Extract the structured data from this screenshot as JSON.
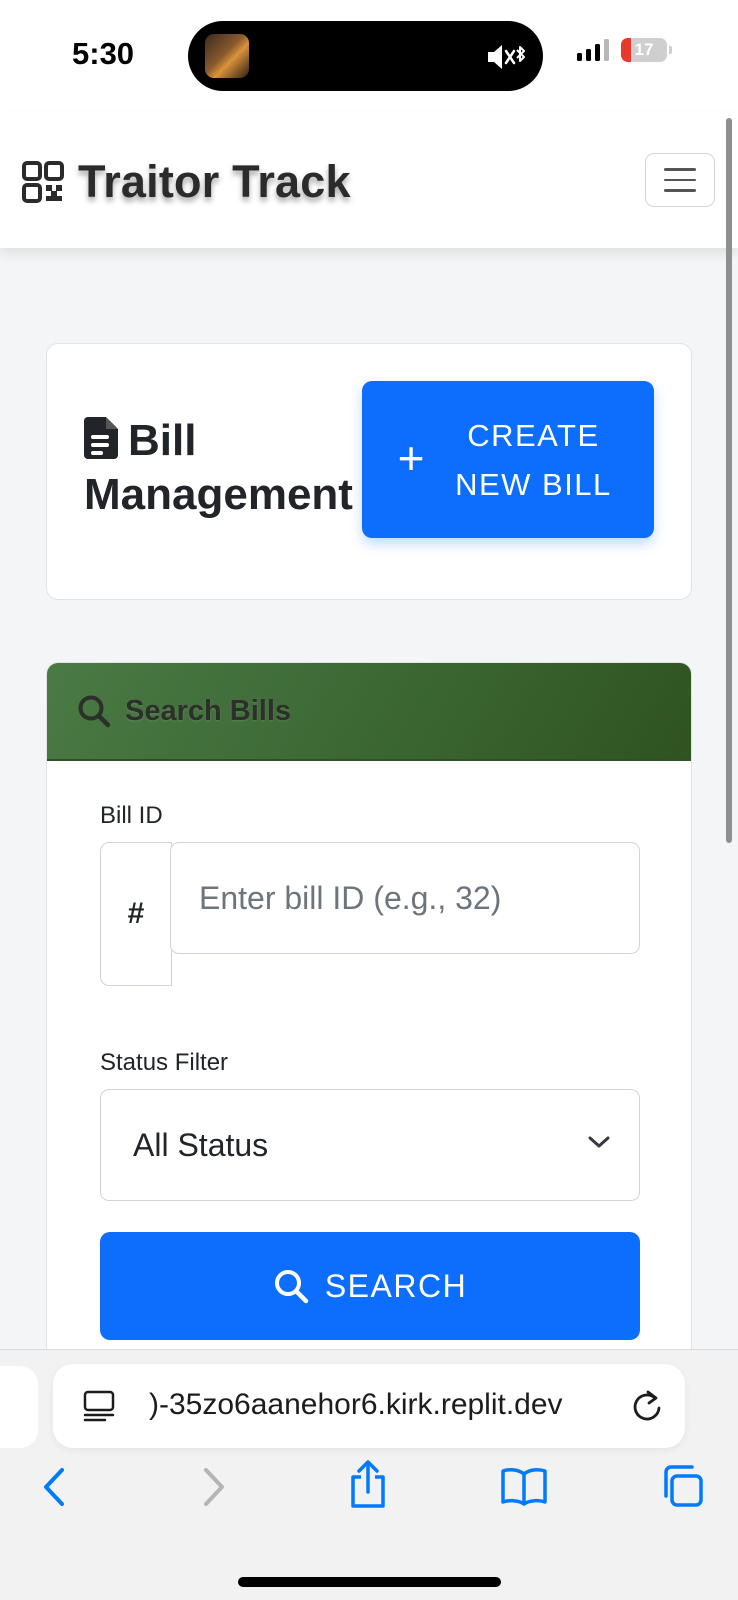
{
  "status_bar": {
    "time": "5:30",
    "battery": "17"
  },
  "navbar": {
    "brand": "Traitor Track"
  },
  "header_card": {
    "title_line1": "Bill",
    "title_line2": "Management",
    "create_button_line1": "CREATE",
    "create_button_line2": "NEW BILL",
    "create_button_icon": "plus-icon"
  },
  "search_card": {
    "heading": "Search Bills",
    "bill_id_label": "Bill ID",
    "bill_id_prefix": "#",
    "bill_id_placeholder": "Enter bill ID (e.g., 32)",
    "status_label": "Status Filter",
    "status_selected": "All Status",
    "search_button": "SEARCH"
  },
  "browser": {
    "url": ")-35zo6aanehor6.kirk.replit.dev"
  },
  "colors": {
    "primary": "#0d6efd",
    "search_header": "#3c6834",
    "battery_low": "#e8392e",
    "ios_blue": "#007aff"
  }
}
